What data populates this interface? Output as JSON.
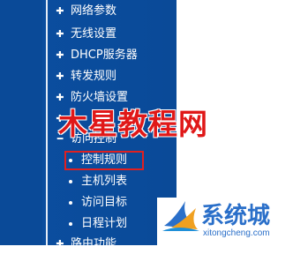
{
  "menu": {
    "items": [
      {
        "label": "网络参数",
        "icon": "plus-icon"
      },
      {
        "label": "无线设置",
        "icon": "plus-icon"
      },
      {
        "label": "DHCP服务器",
        "icon": "plus-icon"
      },
      {
        "label": "转发规则",
        "icon": "plus-icon"
      },
      {
        "label": "防火墙设置",
        "icon": "plus-icon"
      },
      {
        "label": "",
        "icon": "plus-icon"
      },
      {
        "label": "访问控制",
        "icon": "minus-icon"
      },
      {
        "label": "路由功能",
        "icon": "plus-icon"
      }
    ],
    "sub_items": [
      {
        "label": "控制规则"
      },
      {
        "label": "主机列表"
      },
      {
        "label": "访问目标"
      },
      {
        "label": "日程计划"
      }
    ],
    "selected_sub_index": 0
  },
  "watermark": {
    "text": "木星教程网",
    "color": "#e01818"
  },
  "brand": {
    "name": "系统城",
    "url": "xitongcheng.com",
    "color": "#2a6fc9"
  },
  "colors": {
    "sidebar_bg": "#0a4a98",
    "highlight_border": "#e02020"
  }
}
